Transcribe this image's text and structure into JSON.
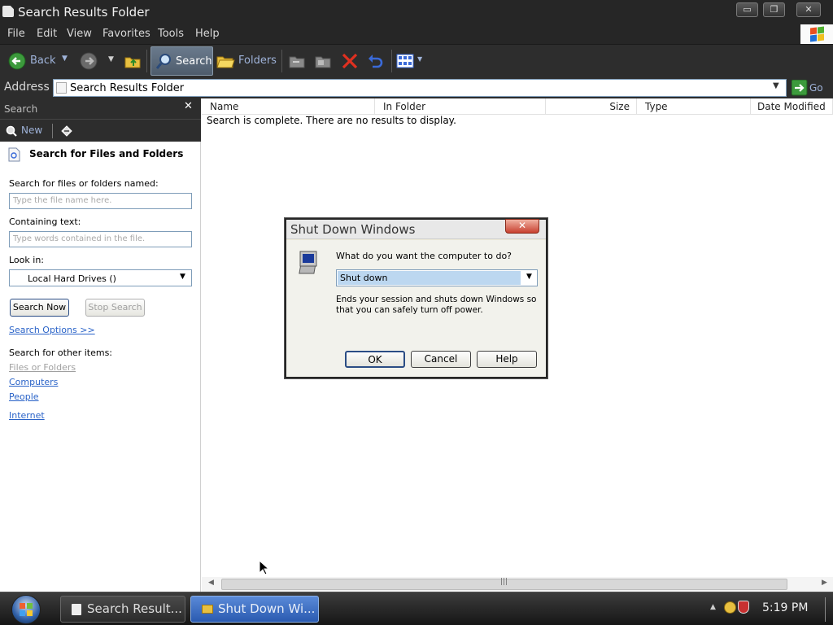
{
  "window": {
    "title": "Search Results Folder",
    "controls": {
      "minimize": "▭",
      "restore": "❐",
      "close": "✕"
    }
  },
  "menu": [
    "File",
    "Edit",
    "View",
    "Favorites",
    "Tools",
    "Help"
  ],
  "toolbar": {
    "back_label": "Back",
    "search_label": "Search",
    "folders_label": "Folders"
  },
  "address": {
    "label": "Address",
    "value": "Search Results Folder",
    "go_label": "Go"
  },
  "search_pane": {
    "header": "Search",
    "new_label": "New",
    "section_title": "Search for Files and Folders",
    "name_label": "Search for files or folders named:",
    "name_placeholder": "Type the file name here.",
    "containing_label": "Containing text:",
    "containing_placeholder": "Type words contained in the file.",
    "look_in_label": "Look in:",
    "look_in_value": "Local Hard Drives ()",
    "search_now": "Search Now",
    "stop_search": "Stop Search",
    "search_options": "Search Options >>",
    "other_items_label": "Search for other items:",
    "other_items": [
      "Files or Folders",
      "Computers",
      "People"
    ],
    "internet": "Internet"
  },
  "results": {
    "columns": [
      "Name",
      "In Folder",
      "Size",
      "Type",
      "Date Modified"
    ],
    "message": "Search is complete. There are no results to display."
  },
  "dialog": {
    "title": "Shut Down Windows",
    "question": "What do you want the computer to do?",
    "selected": "Shut down",
    "description": "Ends your session and shuts down Windows so that you can safely turn off power.",
    "ok": "OK",
    "cancel": "Cancel",
    "help": "Help"
  },
  "taskbar": {
    "tasks": [
      "Search Result...",
      "Shut Down Wi..."
    ],
    "clock": "5:19 PM"
  },
  "colors": {
    "chrome": "#262626",
    "link": "#2a63c8",
    "selection": "#bcd7f0"
  }
}
